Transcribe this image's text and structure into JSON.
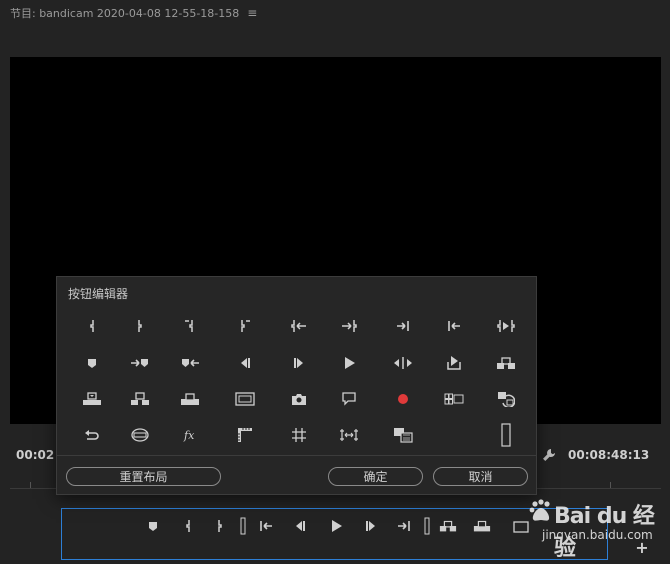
{
  "header": {
    "title": "节目: bandicam 2020-04-08 12-55-18-158",
    "menu_icon": "hamburger-icon"
  },
  "monitor": {
    "timecode_left": "00:02",
    "timecode_right": "00:08:48:13"
  },
  "dialog": {
    "title": "按钮编辑器",
    "buttons": [
      [
        "mark-in-icon",
        "mark-out-icon",
        "mark-clip-in-icon",
        "mark-clip-out-icon",
        "go-to-in-icon",
        "go-to-out-icon",
        "go-to-next-edit-icon",
        "go-to-prev-edit-icon",
        "play-in-to-out-icon"
      ],
      [
        "add-marker-icon",
        "go-to-next-marker-icon",
        "go-to-prev-marker-icon",
        "step-back-icon",
        "step-forward-icon",
        "play-stop-icon",
        "shuttle-icon",
        "export-frame-share-icon",
        "insert-icon"
      ],
      [
        "lift-icon",
        "extract-icon",
        "overwrite-icon",
        "safe-margins-icon",
        "camera-icon",
        "comment-icon",
        "record-icon",
        "multi-camera-icon",
        "toggle-proxies-icon"
      ],
      [
        "loop-icon",
        "vr-video-icon",
        "fx-icon",
        "show-rulers-icon",
        "show-guides-icon",
        "snap-guides-icon",
        "comparison-view-icon",
        "",
        "spacer-icon"
      ]
    ],
    "reset_label": "重置布局",
    "ok_label": "确定",
    "cancel_label": "取消"
  },
  "button_bar": {
    "buttons": [
      "add-marker-icon",
      "mark-in-icon",
      "mark-out-icon",
      "spacer-icon",
      "go-to-in-icon",
      "step-back-icon",
      "play-stop-icon",
      "step-forward-icon",
      "go-to-out-icon",
      "spacer-icon",
      "insert-icon",
      "overwrite-icon",
      "export-frame-icon"
    ],
    "add_label": "+"
  },
  "watermark": {
    "brand": "Bai du 经验",
    "url": "jingyan.baidu.com"
  },
  "colors": {
    "accent_border": "#2d7fd6",
    "record": "#e03a3a",
    "background": "#232323"
  }
}
